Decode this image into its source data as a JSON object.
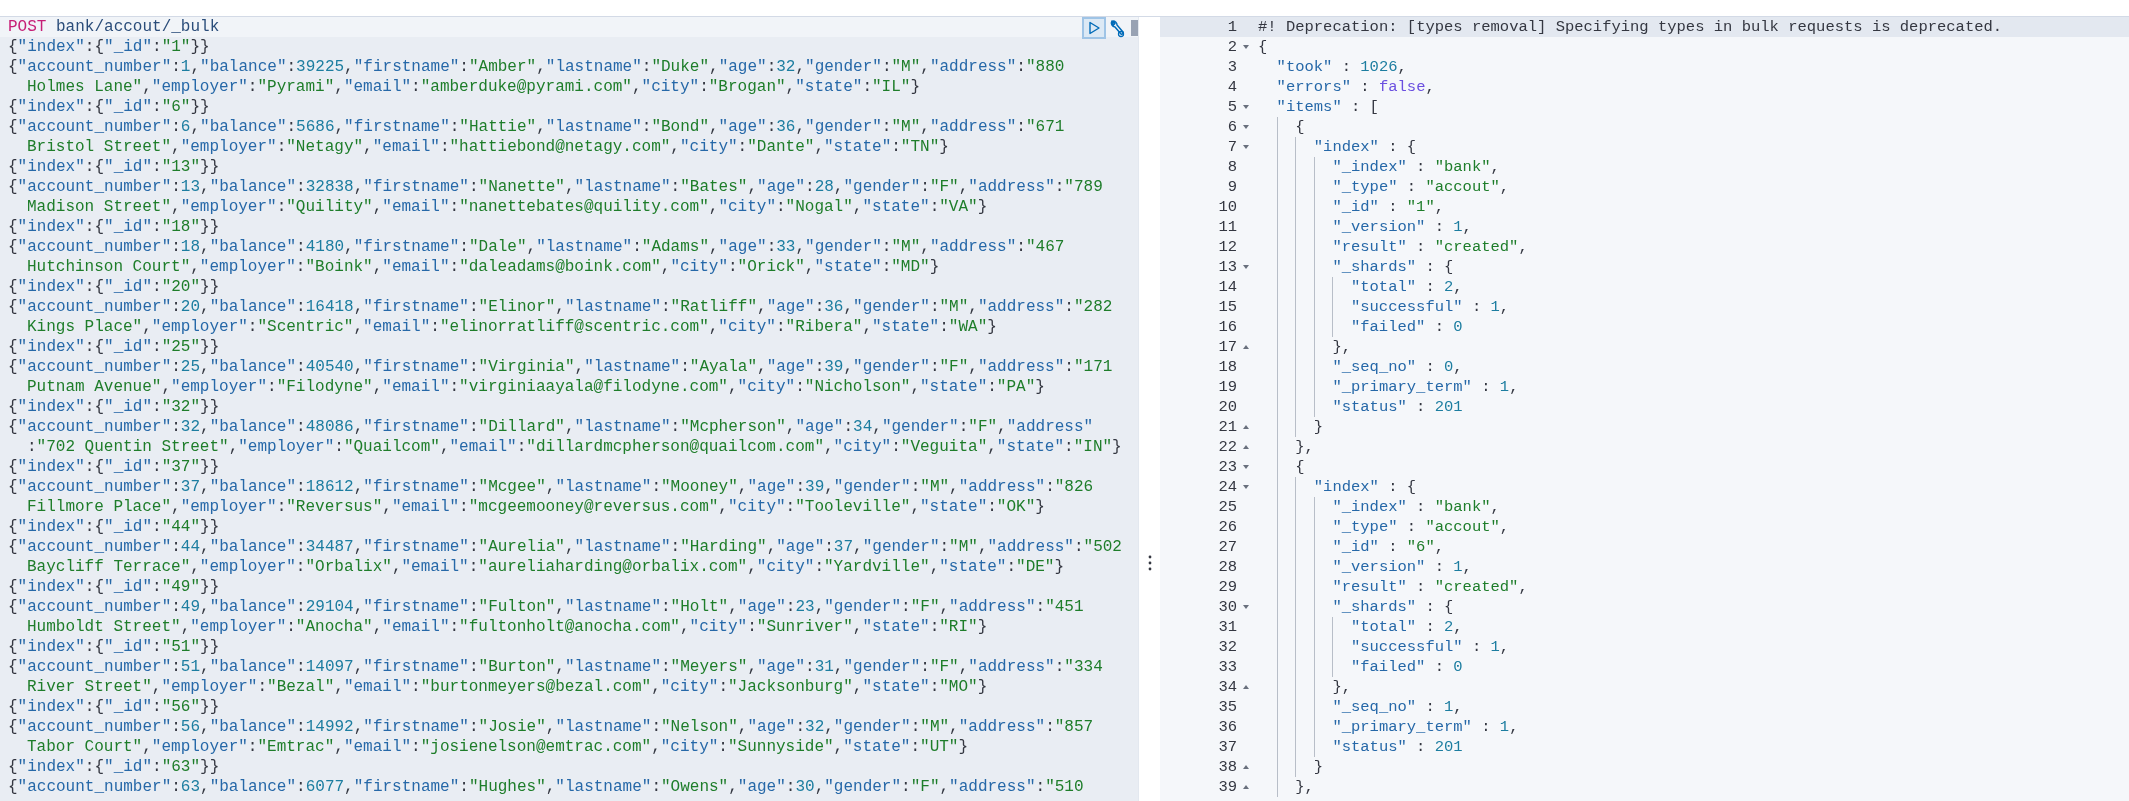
{
  "request_editor": {
    "lines": [
      {
        "kind": "request",
        "method": "POST",
        "path": "bank/accout/_bulk"
      },
      {
        "kind": "body",
        "parts": [
          "{\"index\":{\"_id\":\"1\"}}"
        ]
      },
      {
        "kind": "body",
        "parts": [
          "{\"account_number\":1,\"balance\":39225,\"firstname\":\"Amber\",\"lastname\":\"Duke\",\"age\":32,\"gender\":\"M\",\"address\":\"880",
          "Holmes Lane\",\"employer\":\"Pyrami\",\"email\":\"amberduke@pyrami.com\",\"city\":\"Brogan\",\"state\":\"IL\"}"
        ]
      },
      {
        "kind": "body",
        "parts": [
          "{\"index\":{\"_id\":\"6\"}}"
        ]
      },
      {
        "kind": "body",
        "parts": [
          "{\"account_number\":6,\"balance\":5686,\"firstname\":\"Hattie\",\"lastname\":\"Bond\",\"age\":36,\"gender\":\"M\",\"address\":\"671",
          "Bristol Street\",\"employer\":\"Netagy\",\"email\":\"hattiebond@netagy.com\",\"city\":\"Dante\",\"state\":\"TN\"}"
        ]
      },
      {
        "kind": "body",
        "parts": [
          "{\"index\":{\"_id\":\"13\"}}"
        ]
      },
      {
        "kind": "body",
        "parts": [
          "{\"account_number\":13,\"balance\":32838,\"firstname\":\"Nanette\",\"lastname\":\"Bates\",\"age\":28,\"gender\":\"F\",\"address\":\"789",
          "Madison Street\",\"employer\":\"Quility\",\"email\":\"nanettebates@quility.com\",\"city\":\"Nogal\",\"state\":\"VA\"}"
        ]
      },
      {
        "kind": "body",
        "parts": [
          "{\"index\":{\"_id\":\"18\"}}"
        ]
      },
      {
        "kind": "body",
        "parts": [
          "{\"account_number\":18,\"balance\":4180,\"firstname\":\"Dale\",\"lastname\":\"Adams\",\"age\":33,\"gender\":\"M\",\"address\":\"467",
          "Hutchinson Court\",\"employer\":\"Boink\",\"email\":\"daleadams@boink.com\",\"city\":\"Orick\",\"state\":\"MD\"}"
        ]
      },
      {
        "kind": "body",
        "parts": [
          "{\"index\":{\"_id\":\"20\"}}"
        ]
      },
      {
        "kind": "body",
        "parts": [
          "{\"account_number\":20,\"balance\":16418,\"firstname\":\"Elinor\",\"lastname\":\"Ratliff\",\"age\":36,\"gender\":\"M\",\"address\":\"282",
          "Kings Place\",\"employer\":\"Scentric\",\"email\":\"elinorratliff@scentric.com\",\"city\":\"Ribera\",\"state\":\"WA\"}"
        ]
      },
      {
        "kind": "body",
        "parts": [
          "{\"index\":{\"_id\":\"25\"}}"
        ]
      },
      {
        "kind": "body",
        "parts": [
          "{\"account_number\":25,\"balance\":40540,\"firstname\":\"Virginia\",\"lastname\":\"Ayala\",\"age\":39,\"gender\":\"F\",\"address\":\"171",
          "Putnam Avenue\",\"employer\":\"Filodyne\",\"email\":\"virginiaayala@filodyne.com\",\"city\":\"Nicholson\",\"state\":\"PA\"}"
        ]
      },
      {
        "kind": "body",
        "parts": [
          "{\"index\":{\"_id\":\"32\"}}"
        ]
      },
      {
        "kind": "body",
        "parts": [
          "{\"account_number\":32,\"balance\":48086,\"firstname\":\"Dillard\",\"lastname\":\"Mcpherson\",\"age\":34,\"gender\":\"F\",\"address\"",
          ":\"702 Quentin Street\",\"employer\":\"Quailcom\",\"email\":\"dillardmcpherson@quailcom.com\",\"city\":\"Veguita\",\"state\":\"IN\"}"
        ]
      },
      {
        "kind": "body",
        "parts": [
          "{\"index\":{\"_id\":\"37\"}}"
        ]
      },
      {
        "kind": "body",
        "parts": [
          "{\"account_number\":37,\"balance\":18612,\"firstname\":\"Mcgee\",\"lastname\":\"Mooney\",\"age\":39,\"gender\":\"M\",\"address\":\"826",
          "Fillmore Place\",\"employer\":\"Reversus\",\"email\":\"mcgeemooney@reversus.com\",\"city\":\"Tooleville\",\"state\":\"OK\"}"
        ]
      },
      {
        "kind": "body",
        "parts": [
          "{\"index\":{\"_id\":\"44\"}}"
        ]
      },
      {
        "kind": "body",
        "parts": [
          "{\"account_number\":44,\"balance\":34487,\"firstname\":\"Aurelia\",\"lastname\":\"Harding\",\"age\":37,\"gender\":\"M\",\"address\":\"502",
          "Baycliff Terrace\",\"employer\":\"Orbalix\",\"email\":\"aureliaharding@orbalix.com\",\"city\":\"Yardville\",\"state\":\"DE\"}"
        ]
      },
      {
        "kind": "body",
        "parts": [
          "{\"index\":{\"_id\":\"49\"}}"
        ]
      },
      {
        "kind": "body",
        "parts": [
          "{\"account_number\":49,\"balance\":29104,\"firstname\":\"Fulton\",\"lastname\":\"Holt\",\"age\":23,\"gender\":\"F\",\"address\":\"451",
          "Humboldt Street\",\"employer\":\"Anocha\",\"email\":\"fultonholt@anocha.com\",\"city\":\"Sunriver\",\"state\":\"RI\"}"
        ]
      },
      {
        "kind": "body",
        "parts": [
          "{\"index\":{\"_id\":\"51\"}}"
        ]
      },
      {
        "kind": "body",
        "parts": [
          "{\"account_number\":51,\"balance\":14097,\"firstname\":\"Burton\",\"lastname\":\"Meyers\",\"age\":31,\"gender\":\"F\",\"address\":\"334",
          "River Street\",\"employer\":\"Bezal\",\"email\":\"burtonmeyers@bezal.com\",\"city\":\"Jacksonburg\",\"state\":\"MO\"}"
        ]
      },
      {
        "kind": "body",
        "parts": [
          "{\"index\":{\"_id\":\"56\"}}"
        ]
      },
      {
        "kind": "body",
        "parts": [
          "{\"account_number\":56,\"balance\":14992,\"firstname\":\"Josie\",\"lastname\":\"Nelson\",\"age\":32,\"gender\":\"M\",\"address\":\"857",
          "Tabor Court\",\"employer\":\"Emtrac\",\"email\":\"josienelson@emtrac.com\",\"city\":\"Sunnyside\",\"state\":\"UT\"}"
        ]
      },
      {
        "kind": "body",
        "parts": [
          "{\"index\":{\"_id\":\"63\"}}"
        ]
      },
      {
        "kind": "body",
        "parts": [
          "{\"account_number\":63,\"balance\":6077,\"firstname\":\"Hughes\",\"lastname\":\"Owens\",\"age\":30,\"gender\":\"F\",\"address\":\"510"
        ]
      }
    ]
  },
  "response_viewer": {
    "lines": [
      {
        "number": "1",
        "kind": "comment",
        "active": true,
        "text": "#! Deprecation: [types removal] Specifying types in bulk requests is deprecated."
      },
      {
        "number": "2",
        "kind": "json",
        "active": false,
        "expanded": true,
        "text": "{"
      },
      {
        "number": "3",
        "kind": "json",
        "active": false,
        "text": "  \"took\" : 1026,"
      },
      {
        "number": "4",
        "kind": "json",
        "active": false,
        "text": "  \"errors\" : false,"
      },
      {
        "number": "5",
        "kind": "json",
        "active": false,
        "expanded": true,
        "text": "  \"items\" : ["
      },
      {
        "number": "6",
        "kind": "json",
        "active": false,
        "expanded": true,
        "text": "    {"
      },
      {
        "number": "7",
        "kind": "json",
        "active": false,
        "expanded": true,
        "text": "      \"index\" : {"
      },
      {
        "number": "8",
        "kind": "json",
        "active": false,
        "text": "        \"_index\" : \"bank\","
      },
      {
        "number": "9",
        "kind": "json",
        "active": false,
        "text": "        \"_type\" : \"accout\","
      },
      {
        "number": "10",
        "kind": "json",
        "active": false,
        "text": "        \"_id\" : \"1\","
      },
      {
        "number": "11",
        "kind": "json",
        "active": false,
        "text": "        \"_version\" : 1,"
      },
      {
        "number": "12",
        "kind": "json",
        "active": false,
        "text": "        \"result\" : \"created\","
      },
      {
        "number": "13",
        "kind": "json",
        "active": false,
        "expanded": true,
        "text": "        \"_shards\" : {"
      },
      {
        "number": "14",
        "kind": "json",
        "active": false,
        "text": "          \"total\" : 2,"
      },
      {
        "number": "15",
        "kind": "json",
        "active": false,
        "text": "          \"successful\" : 1,"
      },
      {
        "number": "16",
        "kind": "json",
        "active": false,
        "text": "          \"failed\" : 0"
      },
      {
        "number": "17",
        "kind": "json",
        "active": false,
        "expanded": false,
        "text": "        },"
      },
      {
        "number": "18",
        "kind": "json",
        "active": false,
        "text": "        \"_seq_no\" : 0,"
      },
      {
        "number": "19",
        "kind": "json",
        "active": false,
        "text": "        \"_primary_term\" : 1,"
      },
      {
        "number": "20",
        "kind": "json",
        "active": false,
        "text": "        \"status\" : 201"
      },
      {
        "number": "21",
        "kind": "json",
        "active": false,
        "expanded": false,
        "text": "      }"
      },
      {
        "number": "22",
        "kind": "json",
        "active": false,
        "expanded": false,
        "text": "    },"
      },
      {
        "number": "23",
        "kind": "json",
        "active": false,
        "expanded": true,
        "text": "    {"
      },
      {
        "number": "24",
        "kind": "json",
        "active": false,
        "expanded": true,
        "text": "      \"index\" : {"
      },
      {
        "number": "25",
        "kind": "json",
        "active": false,
        "text": "        \"_index\" : \"bank\","
      },
      {
        "number": "26",
        "kind": "json",
        "active": false,
        "text": "        \"_type\" : \"accout\","
      },
      {
        "number": "27",
        "kind": "json",
        "active": false,
        "text": "        \"_id\" : \"6\","
      },
      {
        "number": "28",
        "kind": "json",
        "active": false,
        "text": "        \"_version\" : 1,"
      },
      {
        "number": "29",
        "kind": "json",
        "active": false,
        "text": "        \"result\" : \"created\","
      },
      {
        "number": "30",
        "kind": "json",
        "active": false,
        "expanded": true,
        "text": "        \"_shards\" : {"
      },
      {
        "number": "31",
        "kind": "json",
        "active": false,
        "text": "          \"total\" : 2,"
      },
      {
        "number": "32",
        "kind": "json",
        "active": false,
        "text": "          \"successful\" : 1,"
      },
      {
        "number": "33",
        "kind": "json",
        "active": false,
        "text": "          \"failed\" : 0"
      },
      {
        "number": "34",
        "kind": "json",
        "active": false,
        "expanded": false,
        "text": "        },"
      },
      {
        "number": "35",
        "kind": "json",
        "active": false,
        "text": "        \"_seq_no\" : 1,"
      },
      {
        "number": "36",
        "kind": "json",
        "active": false,
        "text": "        \"_primary_term\" : 1,"
      },
      {
        "number": "37",
        "kind": "json",
        "active": false,
        "text": "        \"status\" : 201"
      },
      {
        "number": "38",
        "kind": "json",
        "active": false,
        "expanded": false,
        "text": "      }"
      },
      {
        "number": "39",
        "kind": "json",
        "active": false,
        "expanded": false,
        "text": "    },"
      }
    ]
  }
}
